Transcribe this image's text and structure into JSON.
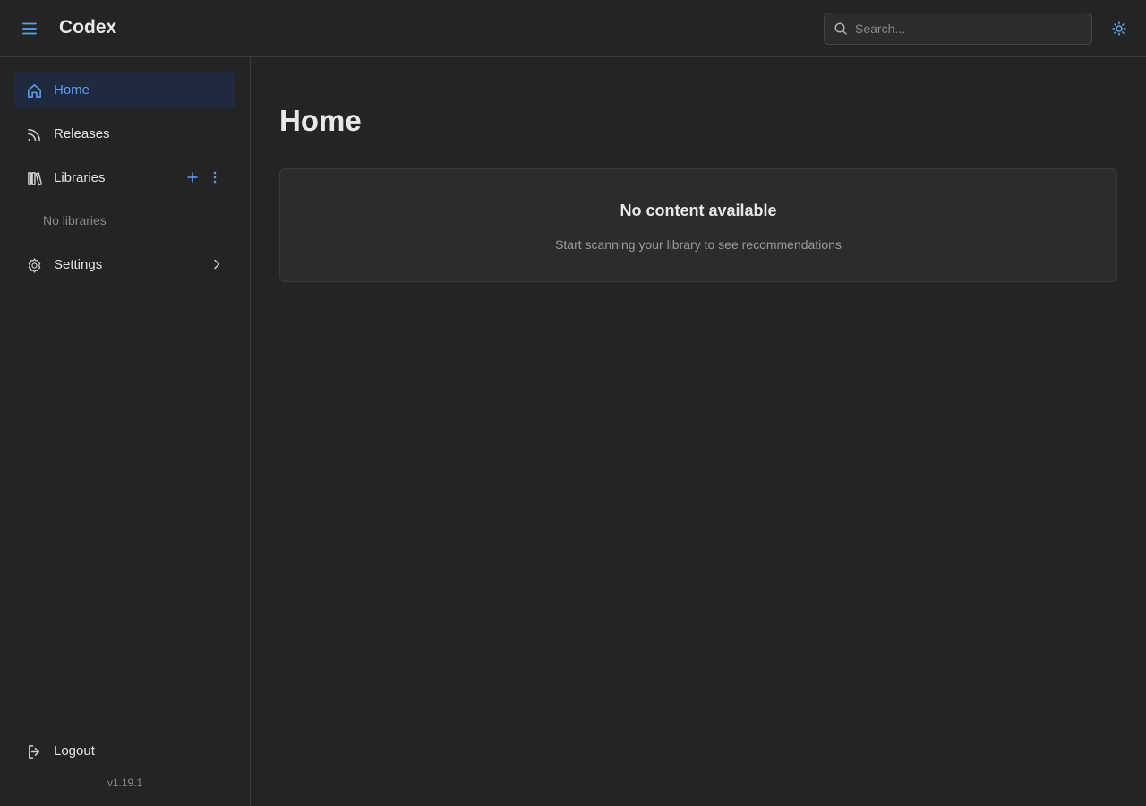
{
  "header": {
    "app_title": "Codex",
    "search": {
      "placeholder": "Search...",
      "value": ""
    },
    "icons": {
      "menu": "hamburger-menu-icon",
      "search": "search-icon",
      "theme": "sun-icon"
    }
  },
  "sidebar": {
    "items": [
      {
        "label": "Home",
        "icon": "home-icon",
        "active": true
      },
      {
        "label": "Releases",
        "icon": "rss-icon",
        "active": false
      },
      {
        "label": "Libraries",
        "icon": "library-icon",
        "active": false
      },
      {
        "label": "Settings",
        "icon": "gear-icon",
        "active": false
      }
    ],
    "libraries_empty": "No libraries",
    "logout_label": "Logout",
    "version": "v1.19.1"
  },
  "main": {
    "title": "Home",
    "empty_state": {
      "title": "No content available",
      "subtitle": "Start scanning your library to see recommendations"
    }
  },
  "colors": {
    "background": "#242424",
    "accent": "#5fa0f5",
    "active_bg": "#1f2a3e",
    "card_bg": "#2c2c2c",
    "border": "#3a3a3a"
  }
}
